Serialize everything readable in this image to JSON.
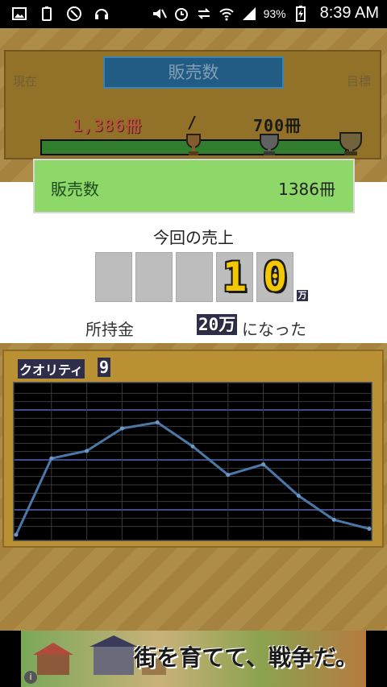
{
  "status_bar": {
    "battery_percent": "93%",
    "time": "8:39 AM"
  },
  "sales_panel": {
    "header": "販売数",
    "current_label": "現在",
    "target_label": "目標",
    "current_value": "1,386冊",
    "separator": "/",
    "target_value": "700冊",
    "progress": 1.0
  },
  "dialog": {
    "header_label": "販売数",
    "header_value": "1386冊",
    "sales_title": "今回の売上",
    "sales_digits": [
      "",
      "",
      "",
      "1",
      "0"
    ],
    "sales_unit": "万",
    "money_label": "所持金",
    "money_value": "20万",
    "money_suffix": "になった"
  },
  "quality": {
    "label": "クオリティ",
    "value": "9"
  },
  "chart_data": {
    "type": "line",
    "x": [
      0,
      1,
      2,
      3,
      4,
      5,
      6,
      7,
      8,
      9,
      10
    ],
    "values": [
      0.0,
      0.51,
      0.56,
      0.71,
      0.75,
      0.59,
      0.4,
      0.47,
      0.26,
      0.1,
      0.04
    ],
    "ylim": [
      0,
      1
    ],
    "grid": true,
    "colors": {
      "line": "#4a78a8",
      "grid": "#3a3a3a",
      "band": "#3d4f8a",
      "background": "#000000"
    }
  },
  "ad": {
    "text": "街を育てて、戦争だ。",
    "info_icon": "i"
  },
  "colors": {
    "header_blue": "#2a6fa0",
    "dialog_green": "#8ed86a",
    "digit_yellow": "#f4c800",
    "panel_gold": "#b99034"
  }
}
